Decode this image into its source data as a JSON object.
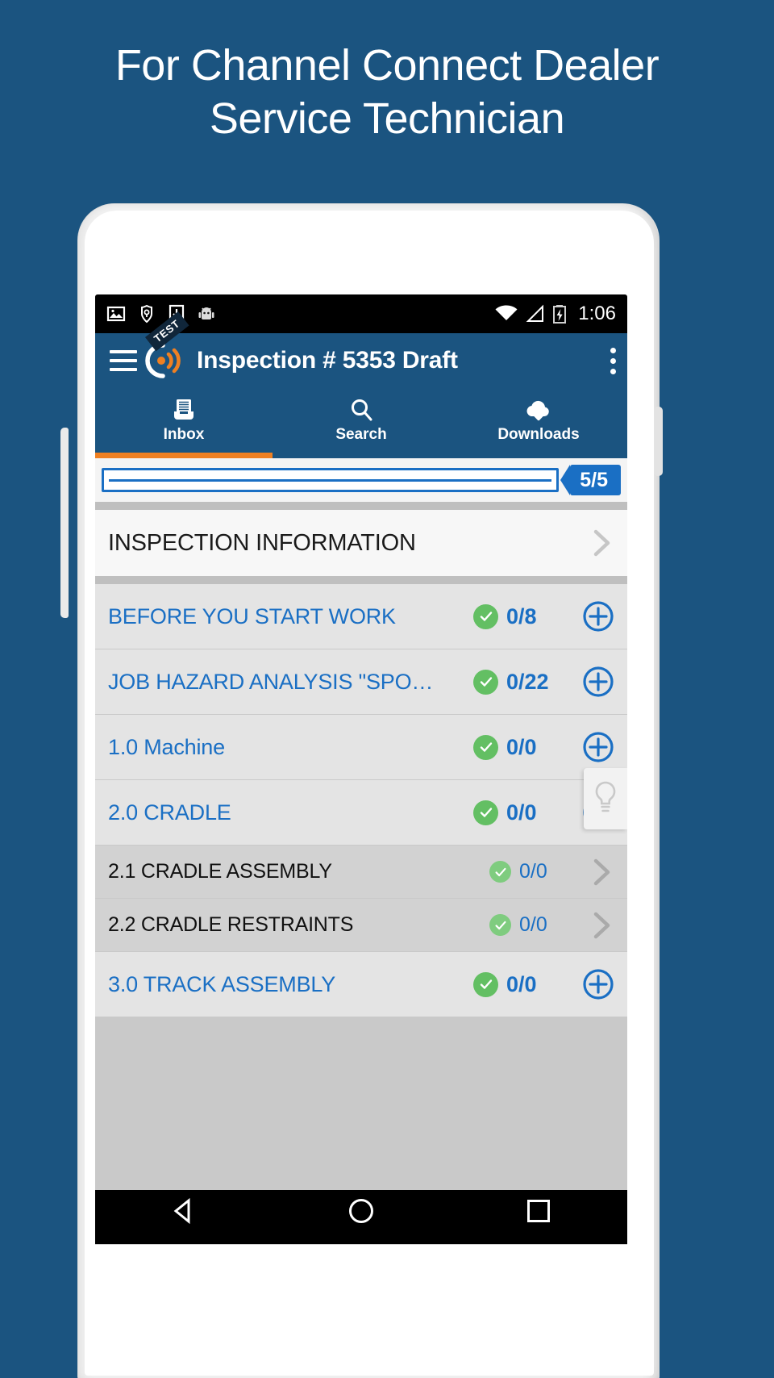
{
  "promo": {
    "line1": "For Channel Connect Dealer",
    "line2": "Service Technician",
    "background_color": "#1b5480",
    "text_color": "#ffffff"
  },
  "statusbar": {
    "left_icons": [
      "image-icon",
      "shield-location-icon",
      "download-to-device-icon",
      "android-robot-icon"
    ],
    "right_icons": [
      "wifi-icon",
      "cell-signal-icon",
      "battery-charging-icon"
    ],
    "clock": "1:06"
  },
  "appbar": {
    "menu_icon": "hamburger-menu-icon",
    "logo": {
      "name": "channel-connect-logo",
      "ribbon_label": "TEST",
      "accent_color": "#ef8022"
    },
    "title": "Inspection # 5353 Draft",
    "overflow_icon": "more-vertical-icon",
    "background_color": "#1b5480"
  },
  "tabs": {
    "active_index": 0,
    "active_underline_color": "#ef8022",
    "items": [
      {
        "label": "Inbox",
        "icon": "inbox-tray-icon"
      },
      {
        "label": "Search",
        "icon": "search-icon"
      },
      {
        "label": "Downloads",
        "icon": "cloud-download-icon"
      }
    ]
  },
  "progress": {
    "badge": "5/5",
    "badge_color": "#1a6fc4",
    "fill_percent": 100
  },
  "section_header": {
    "title": "INSPECTION INFORMATION",
    "chevron_icon": "chevron-right-icon"
  },
  "checklist": {
    "check_color": "#63bf63",
    "link_color": "#1a6fc4",
    "rows": [
      {
        "level": 1,
        "title": "BEFORE YOU START WORK",
        "status_icon": "check-circle-icon",
        "count": "0/8",
        "action_icon": "plus-circle-icon"
      },
      {
        "level": 1,
        "title": "JOB HAZARD ANALYSIS \"SPO…",
        "status_icon": "check-circle-icon",
        "count": "0/22",
        "action_icon": "plus-circle-icon"
      },
      {
        "level": 1,
        "title": "1.0 Machine",
        "status_icon": "check-circle-icon",
        "count": "0/0",
        "action_icon": "plus-circle-icon"
      },
      {
        "level": 1,
        "title": "2.0 CRADLE",
        "status_icon": "check-circle-icon",
        "count": "0/0",
        "action_icon": "plus-circle-icon"
      },
      {
        "level": 2,
        "title": "2.1 CRADLE ASSEMBLY",
        "status_icon": "check-circle-icon",
        "count": "0/0",
        "action_icon": "chevron-right-icon"
      },
      {
        "level": 2,
        "title": "2.2 CRADLE RESTRAINTS",
        "status_icon": "check-circle-icon",
        "count": "0/0",
        "action_icon": "chevron-right-icon"
      },
      {
        "level": 1,
        "title": "3.0 TRACK ASSEMBLY",
        "status_icon": "check-circle-icon",
        "count": "0/0",
        "action_icon": "plus-circle-icon"
      }
    ]
  },
  "hint_overlay": {
    "icon": "lightbulb-icon"
  },
  "navbar": {
    "back_icon": "back-triangle-icon",
    "home_icon": "home-circle-icon",
    "recents_icon": "recents-square-icon"
  }
}
